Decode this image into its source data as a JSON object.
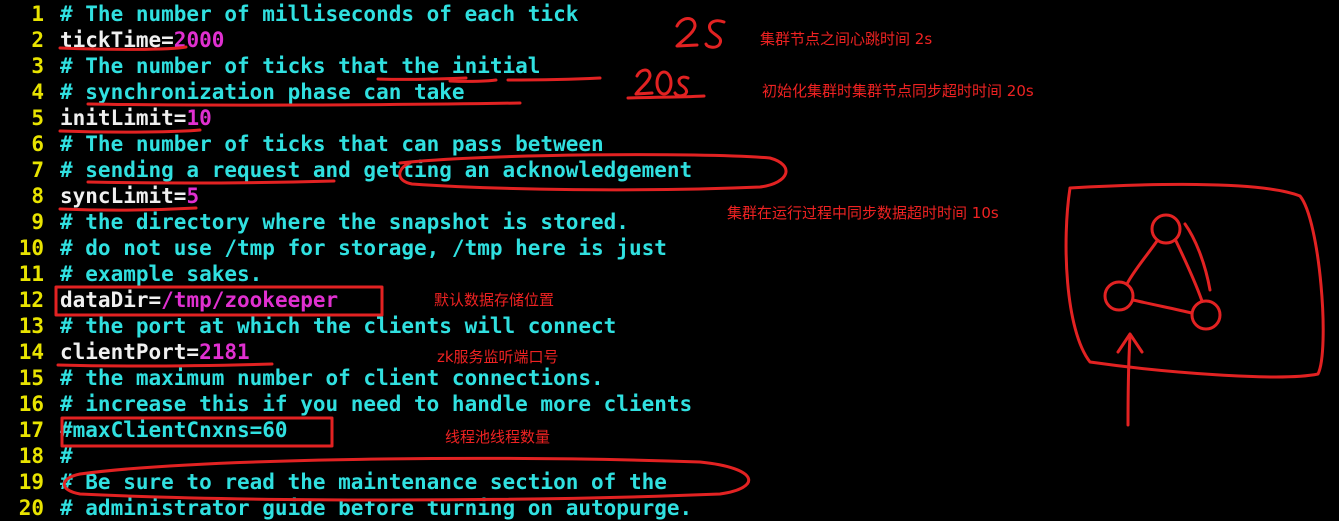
{
  "lines": [
    {
      "n": "1",
      "comment": "# The number of milliseconds of each tick"
    },
    {
      "n": "2",
      "key": "tickTime=",
      "val": "2000"
    },
    {
      "n": "3",
      "comment": "# The number of ticks that the initial"
    },
    {
      "n": "4",
      "comment": "# synchronization phase can take"
    },
    {
      "n": "5",
      "key": "initLimit=",
      "val": "10"
    },
    {
      "n": "6",
      "comment": "# The number of ticks that can pass between"
    },
    {
      "n": "7",
      "comment": "# sending a request and getting an acknowledgement"
    },
    {
      "n": "8",
      "key": "syncLimit=",
      "val": "5"
    },
    {
      "n": "9",
      "comment": "# the directory where the snapshot is stored."
    },
    {
      "n": "10",
      "comment": "# do not use /tmp for storage, /tmp here is just"
    },
    {
      "n": "11",
      "comment": "# example sakes."
    },
    {
      "n": "12",
      "key": "dataDir=",
      "val": "/tmp/zookeeper"
    },
    {
      "n": "13",
      "comment": "# the port at which the clients will connect"
    },
    {
      "n": "14",
      "key": "clientPort=",
      "val": "2181"
    },
    {
      "n": "15",
      "comment": "# the maximum number of client connections."
    },
    {
      "n": "16",
      "comment": "# increase this if you need to handle more clients"
    },
    {
      "n": "17",
      "comment": "#maxClientCnxns=60"
    },
    {
      "n": "18",
      "comment": "#"
    },
    {
      "n": "19",
      "comment": "# Be sure to read the maintenance section of the"
    },
    {
      "n": "20",
      "comment": "# administrator guide before turning on autopurge."
    }
  ],
  "annotations": {
    "tick_note": "集群节点之间心跳时间 2s",
    "init_note": "初始化集群时集群节点同步超时时间 20s",
    "sync_note": "集群在运行过程中同步数据超时时间 10s",
    "datadir_note": "默认数据存储位置",
    "port_note": "zk服务监听端口号",
    "maxcnxns_note": "线程池线程数量",
    "handwritten_2s": "2S",
    "handwritten_20s": "20s"
  },
  "colors": {
    "background": "#000000",
    "line_number": "#e8e300",
    "comment": "#30e0e0",
    "key": "#f0f0f0",
    "value": "#e030d0",
    "annotation_ink": "#e22222"
  }
}
